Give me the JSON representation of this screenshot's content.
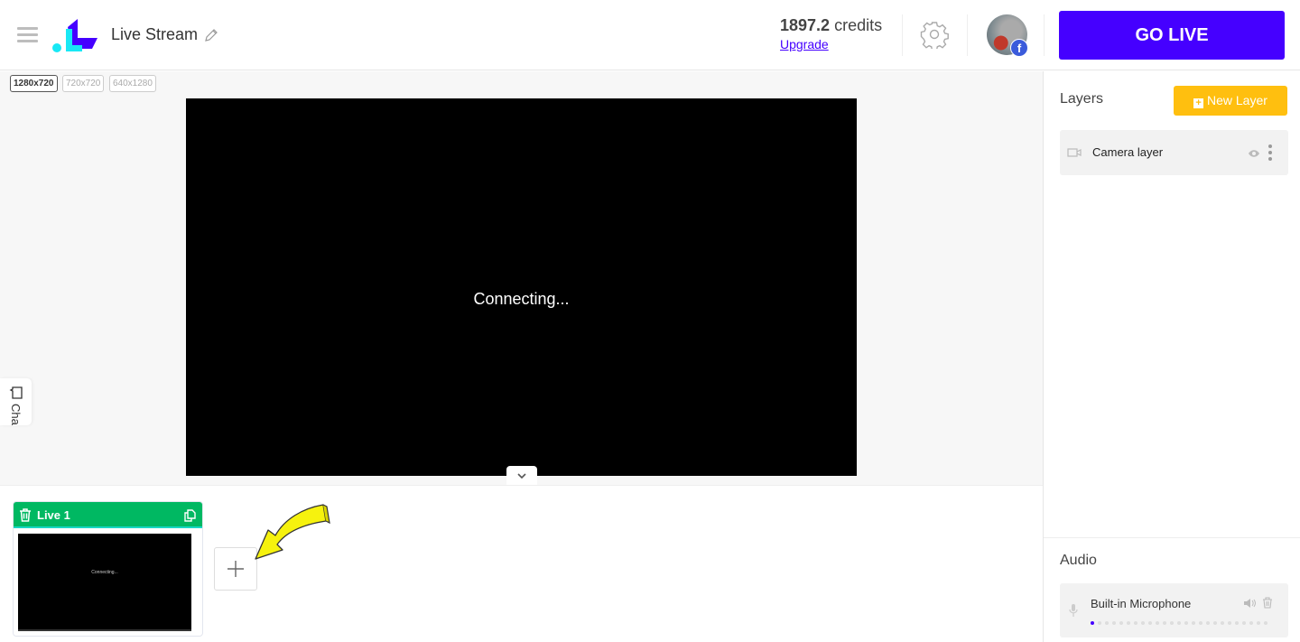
{
  "header": {
    "title": "Live Stream",
    "credits_value": "1897.2",
    "credits_unit": "credits",
    "upgrade_label": "Upgrade",
    "go_live_label": "GO LIVE",
    "avatar_badge": "f",
    "accent_color": "#4500ff"
  },
  "canvas": {
    "resolutions": [
      {
        "label": "1280x720",
        "active": true
      },
      {
        "label": "720x720",
        "active": false
      },
      {
        "label": "640x1280",
        "active": false
      }
    ],
    "status_text": "Connecting...",
    "chat_tab_label": "Chat"
  },
  "scenes": {
    "items": [
      {
        "name": "Live 1",
        "thumb_text": "Connecting...",
        "color": "#00b862"
      }
    ]
  },
  "layers": {
    "title": "Layers",
    "new_layer_label": "New Layer",
    "items": [
      {
        "name": "Camera layer",
        "icon": "video-camera-icon"
      }
    ]
  },
  "audio": {
    "title": "Audio",
    "items": [
      {
        "name": "Built-in Microphone",
        "level_segments_active": 1,
        "level_segments_total": 25
      }
    ]
  }
}
